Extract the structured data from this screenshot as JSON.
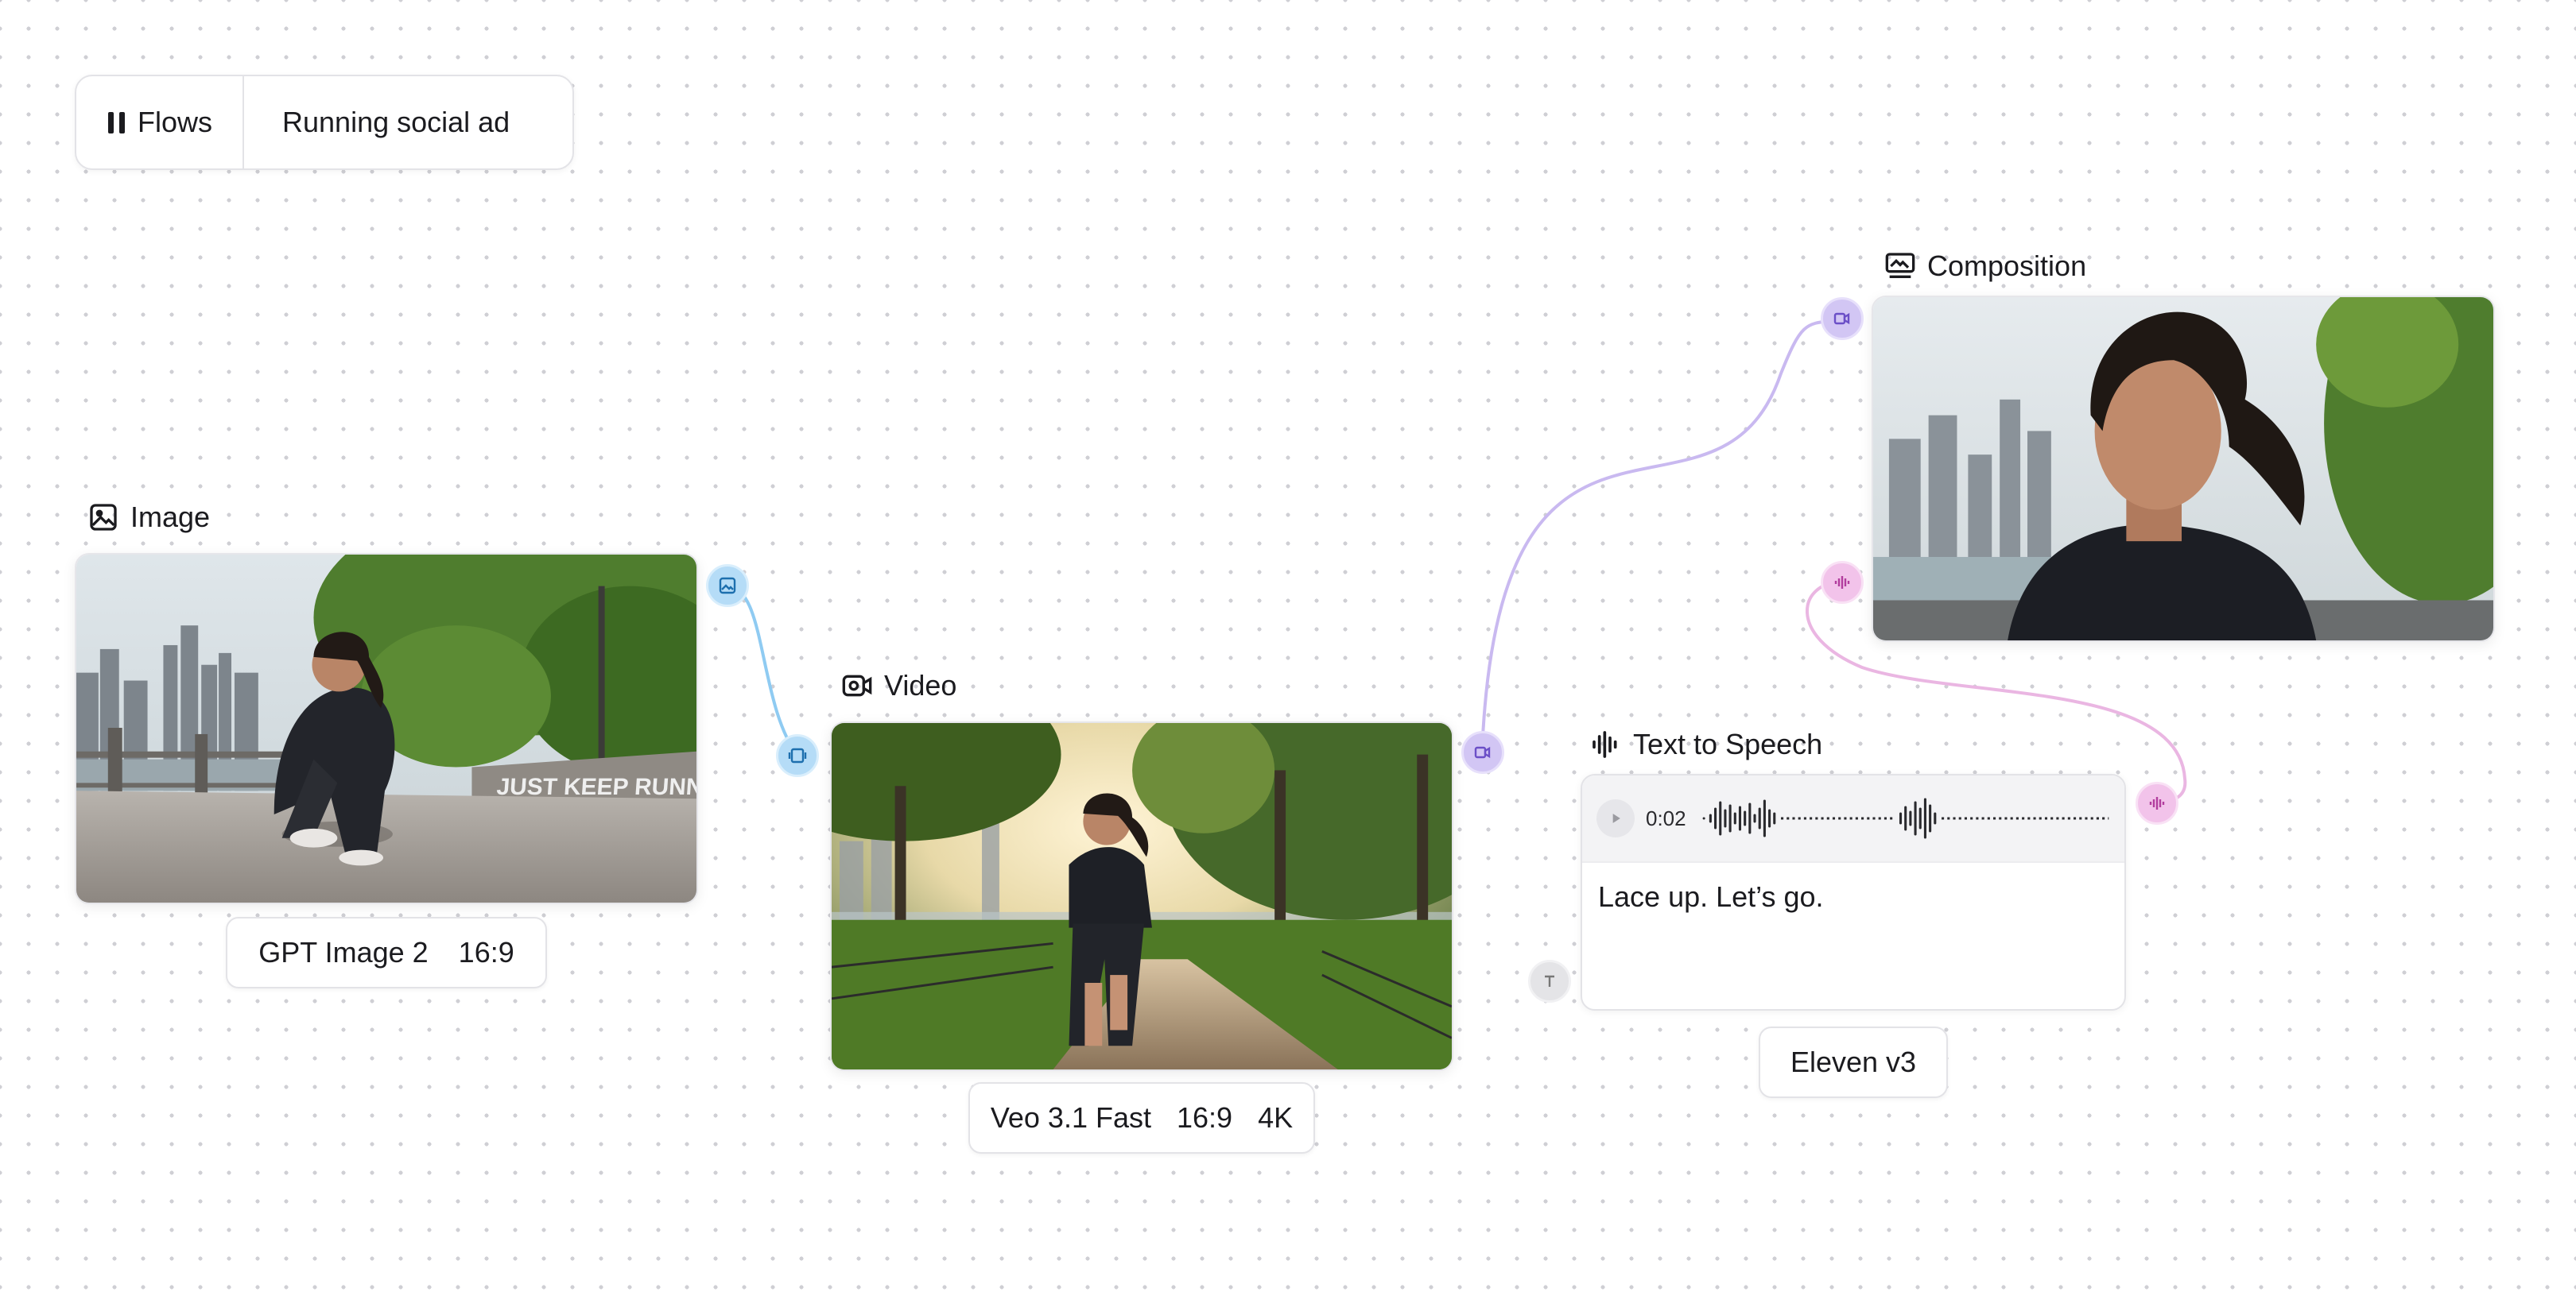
{
  "breadcrumb": {
    "flows_label": "Flows",
    "flow_name": "Running social ad"
  },
  "image_node": {
    "title": "Image",
    "image_alt": "Woman tying running shoe on riverside path with city skyline",
    "sign_text": "JUST KEEP RUNNING",
    "settings": [
      "GPT Image 2",
      "16:9"
    ]
  },
  "video_node": {
    "title": "Video",
    "image_alt": "Woman jogging on tree-lined park path at sunrise",
    "settings": [
      "Veo 3.1 Fast",
      "16:9",
      "4K"
    ]
  },
  "composition_node": {
    "title": "Composition",
    "image_alt": "Close-up of woman running by the river with city skyline"
  },
  "tts_node": {
    "title": "Text to Speech",
    "time": "0:02",
    "text": "Lace up. Let’s go.",
    "model": "Eleven v3"
  },
  "colors": {
    "image_edge": "#8fcbf2",
    "video_edge": "#c9b9f0",
    "audio_edge": "#eab6e2"
  }
}
